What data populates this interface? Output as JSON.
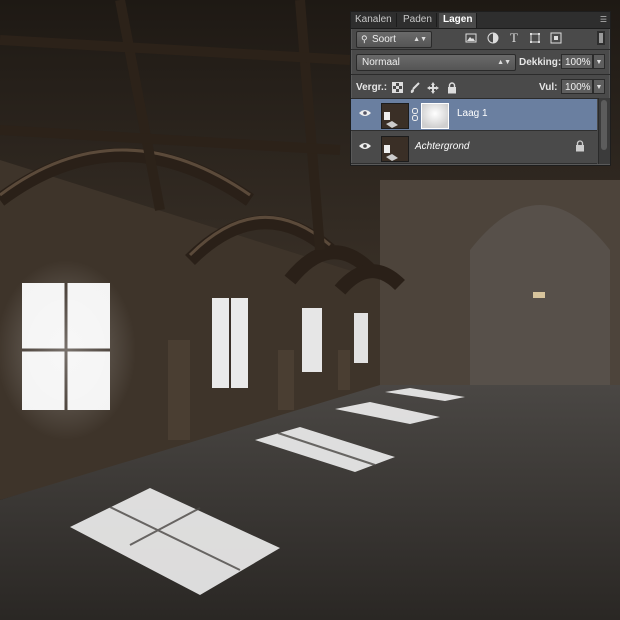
{
  "panel": {
    "tabs": [
      {
        "label": "Kanalen",
        "active": false
      },
      {
        "label": "Paden",
        "active": false
      },
      {
        "label": "Lagen",
        "active": true
      }
    ],
    "filter": {
      "label": "Soort"
    },
    "filter_icons": [
      "image-filter-icon",
      "adjustment-filter-icon",
      "type-filter-icon",
      "shape-filter-icon",
      "smart-object-filter-icon"
    ],
    "blend_mode": {
      "value": "Normaal"
    },
    "opacity": {
      "label": "Dekking:",
      "value": "100%"
    },
    "lock": {
      "label": "Vergr.:",
      "icons": [
        "lock-transparent-icon",
        "lock-image-icon",
        "lock-position-icon",
        "lock-all-icon"
      ]
    },
    "fill": {
      "label": "Vul:",
      "value": "100%"
    },
    "layers": [
      {
        "name": "Laag 1",
        "selected": true,
        "visible": true,
        "has_mask": true,
        "locked": false
      },
      {
        "name": "Achtergrond",
        "selected": false,
        "visible": true,
        "has_mask": false,
        "locked": true
      }
    ]
  },
  "colors": {
    "panel_bg": "#4a4a4a",
    "selected_layer": "#6a7fa0",
    "tab_bar": "#2e2e2e"
  }
}
